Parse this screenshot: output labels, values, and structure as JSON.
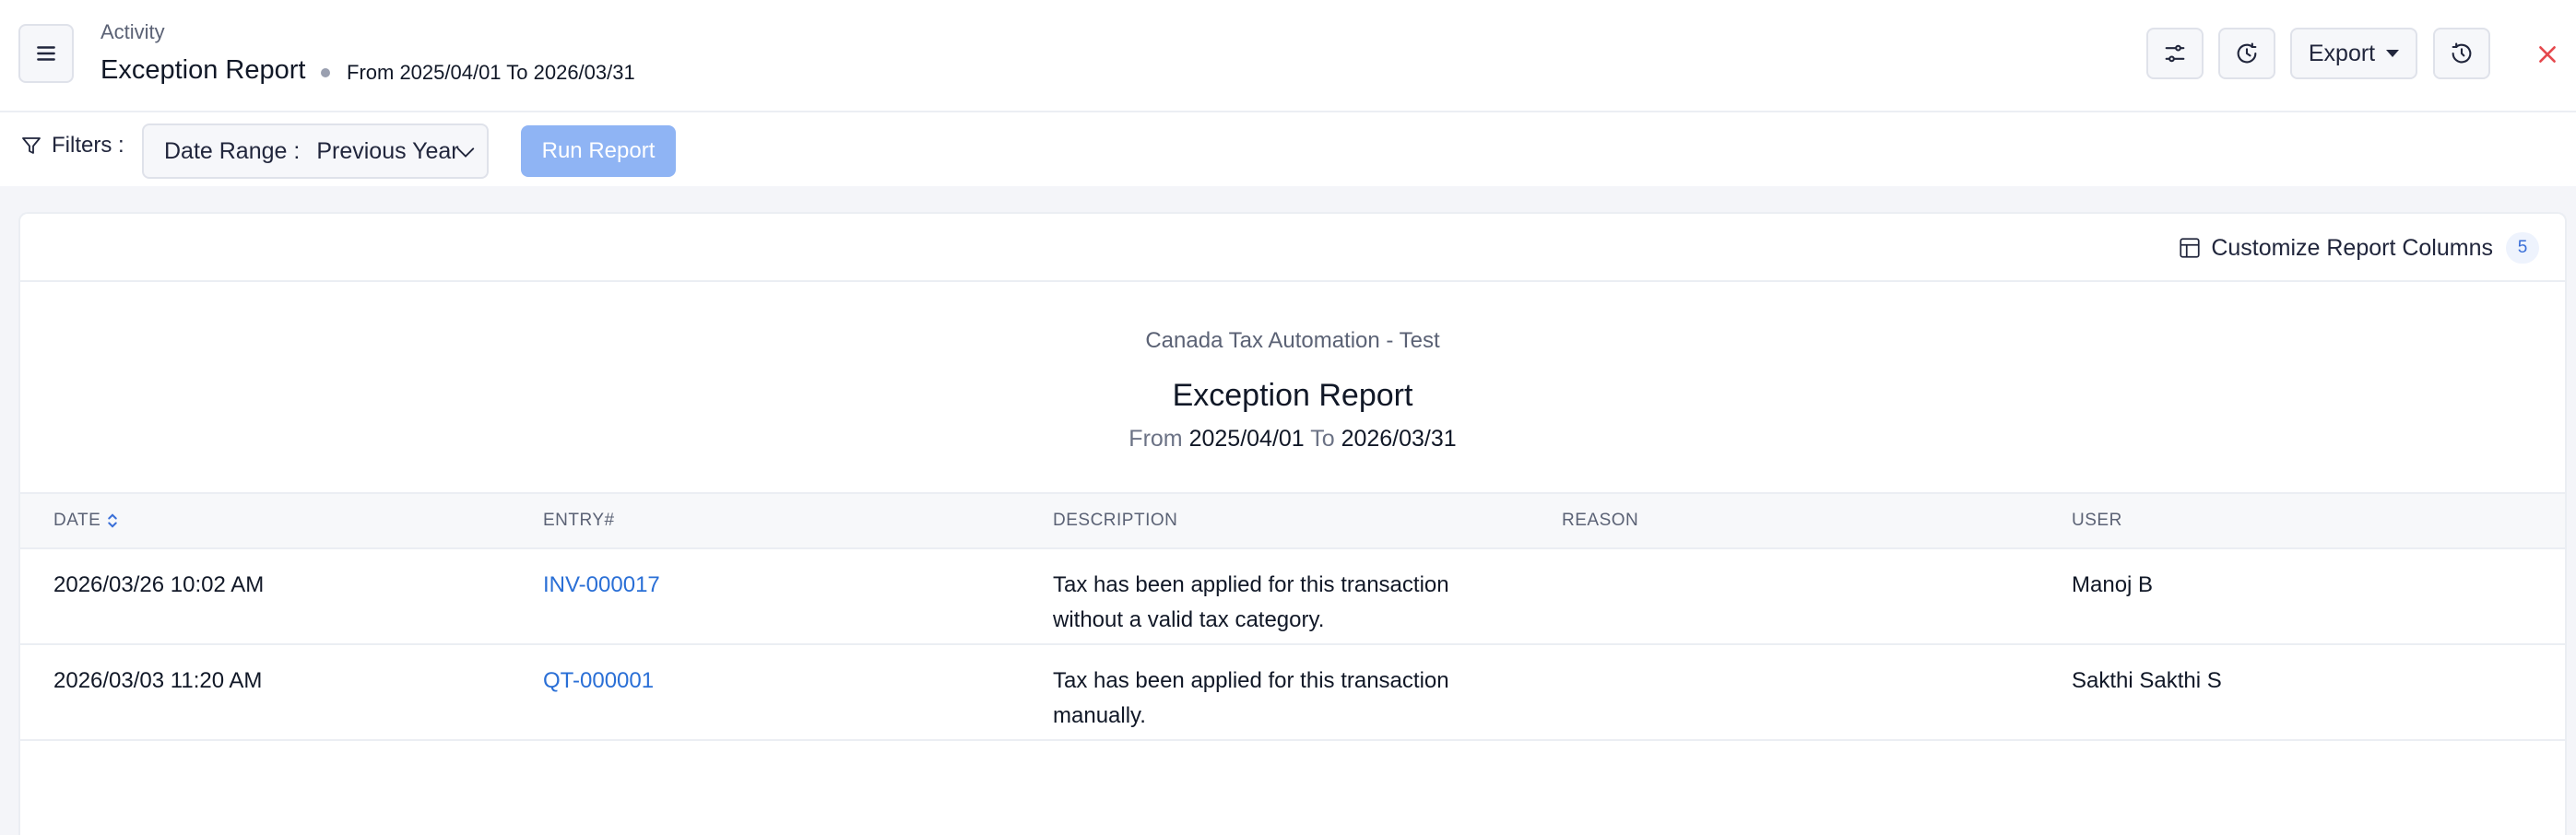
{
  "header": {
    "breadcrumb": "Activity",
    "title": "Exception Report",
    "period": "From 2025/04/01 To 2026/03/31",
    "export_label": "Export"
  },
  "filters": {
    "label": "Filters :",
    "date_range_label": "Date Range :",
    "date_range_value": "Previous Year",
    "run_label": "Run Report"
  },
  "report": {
    "customize_label": "Customize Report Columns",
    "customize_count": "5",
    "organization": "Canada Tax Automation - Test",
    "title": "Exception Report",
    "from_label": "From",
    "from_date": "2025/04/01",
    "to_label": "To",
    "to_date": "2026/03/31"
  },
  "table": {
    "columns": [
      "DATE",
      "ENTRY#",
      "DESCRIPTION",
      "REASON",
      "USER"
    ],
    "rows": [
      {
        "date": "2026/03/26 10:02 AM",
        "entry": "INV-000017",
        "description": "Tax has been applied for this transaction without a valid tax category.",
        "reason": "",
        "user": "Manoj B"
      },
      {
        "date": "2026/03/03 11:20 AM",
        "entry": "QT-000001",
        "description": "Tax has been applied for this transaction manually.",
        "reason": "",
        "user": "Sakthi Sakthi S"
      }
    ]
  },
  "colors": {
    "link": "#2a6fd6",
    "run_button": "#8fb4f4",
    "close": "#e5484d"
  },
  "icons": [
    "menu-icon",
    "sliders-icon",
    "refresh-clock-icon",
    "history-icon",
    "close-icon",
    "filter-icon",
    "chevron-down-icon",
    "columns-icon",
    "sort-icon"
  ]
}
